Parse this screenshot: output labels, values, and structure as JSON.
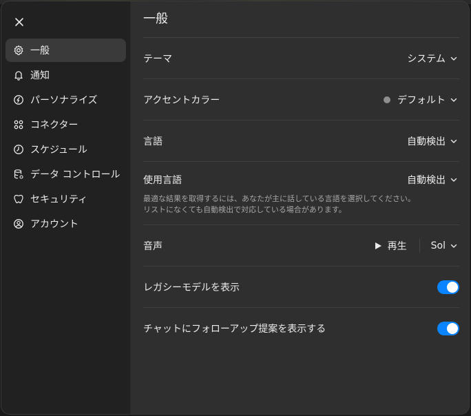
{
  "sidebar": {
    "items": [
      {
        "label": "一般",
        "icon": "gear-icon",
        "active": true
      },
      {
        "label": "通知",
        "icon": "bell-icon"
      },
      {
        "label": "パーソナライズ",
        "icon": "personalize-icon"
      },
      {
        "label": "コネクター",
        "icon": "connectors-icon"
      },
      {
        "label": "スケジュール",
        "icon": "clock-icon"
      },
      {
        "label": "データ コントロール",
        "icon": "database-icon"
      },
      {
        "label": "セキュリティ",
        "icon": "shield-icon"
      },
      {
        "label": "アカウント",
        "icon": "account-icon"
      }
    ]
  },
  "main": {
    "title": "一般",
    "theme": {
      "label": "テーマ",
      "value": "システム"
    },
    "accent": {
      "label": "アクセントカラー",
      "value": "デフォルト",
      "dot_color": "#8e8e8e"
    },
    "language": {
      "label": "言語",
      "value": "自動検出"
    },
    "spoken_language": {
      "label": "使用言語",
      "value": "自動検出",
      "description": "最適な結果を取得するには、あなたが主に話している言語を選択してください。リストになくても自動検出で対応している場合があります。"
    },
    "voice": {
      "label": "音声",
      "play_label": "再生",
      "value": "Sol"
    },
    "legacy_models": {
      "label": "レガシーモデルを表示",
      "enabled": true
    },
    "followup": {
      "label": "チャットにフォローアップ提案を表示する",
      "enabled": true
    }
  },
  "colors": {
    "toggle_on": "#0b84ff",
    "panel": "#2f2f2f",
    "sidebar": "#212121"
  }
}
